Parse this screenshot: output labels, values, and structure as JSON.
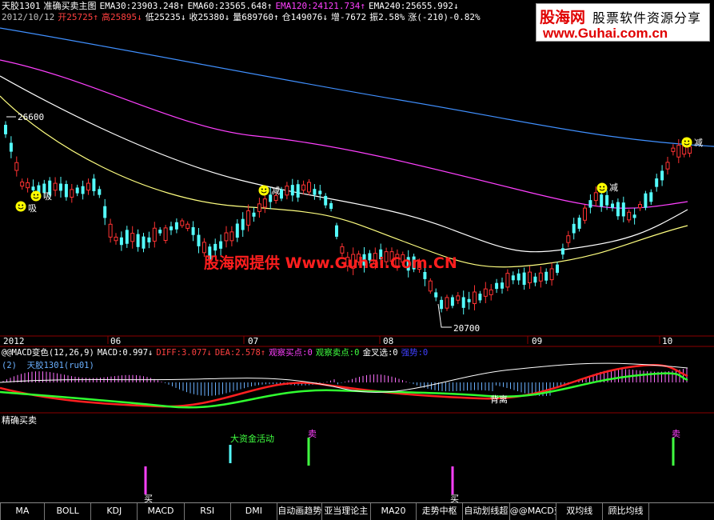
{
  "header": {
    "line1": [
      {
        "text": "天胶1301",
        "color": "#ffffff"
      },
      {
        "text": "准确买卖主图",
        "color": "#ffffff"
      },
      {
        "text": "EMA30:23903.248↑",
        "color": "#ffffff"
      },
      {
        "text": "EMA60:23565.648↑",
        "color": "#ffffff"
      },
      {
        "text": "EMA120:24121.734↑",
        "color": "#ff40ff"
      },
      {
        "text": "EMA240:25655.992↓",
        "color": "#ffffff"
      }
    ],
    "line2": [
      {
        "text": "2012/10/12",
        "color": "#c0c0c0"
      },
      {
        "text": "开25725↑",
        "color": "#ff4040"
      },
      {
        "text": "高25895↓",
        "color": "#ff4040"
      },
      {
        "text": "低25235↓",
        "color": "#ffffff"
      },
      {
        "text": "收25380↓",
        "color": "#ffffff"
      },
      {
        "text": "量689760↑",
        "color": "#ffffff"
      },
      {
        "text": "仓149076↓",
        "color": "#ffffff"
      },
      {
        "text": "增-7672",
        "color": "#ffffff"
      },
      {
        "text": "振2.58%",
        "color": "#ffffff"
      },
      {
        "text": "涨(-210)-0.82%",
        "color": "#ffffff"
      }
    ]
  },
  "logo": {
    "name": "股海网",
    "slogan": "股票软件资源分享",
    "url": "www.Guhai.com.cn"
  },
  "watermark": "股海网提供 Www.Guhai.Com.CN",
  "price_chart": {
    "high_label": "26600",
    "low_label": "20700",
    "signals": [
      {
        "label": "吸"
      },
      {
        "label": "吸"
      },
      {
        "label": "减"
      },
      {
        "label": "减"
      },
      {
        "label": "减"
      }
    ],
    "time_axis": [
      "2012",
      "06",
      "07",
      "08",
      "09",
      "10"
    ],
    "colors": {
      "up": "#ff3232",
      "down": "#54fcfc",
      "ema30": "#ffff80",
      "ema60": "#ffffff",
      "ema120": "#ff40ff",
      "ema240": "#4090ff"
    }
  },
  "macd_panel": {
    "header": [
      {
        "text": "@@MACD变色(12,26,9)",
        "color": "#ffffff"
      },
      {
        "text": "MACD:0.997↓",
        "color": "#ffffff"
      },
      {
        "text": "DIFF:3.077↓",
        "color": "#ff4040"
      },
      {
        "text": "DEA:2.578↑",
        "color": "#ff4040"
      },
      {
        "text": "观察买点:0",
        "color": "#ff40ff"
      },
      {
        "text": "观察卖点:0",
        "color": "#40ff40"
      },
      {
        "text": "金叉选:0",
        "color": "#ffffff"
      },
      {
        "text": "强势:0",
        "color": "#4040ff"
      }
    ],
    "sub_label": "(2)  天胶1301(ru01)",
    "divergence_label": "背离"
  },
  "signal_panel": {
    "title": "精确买卖",
    "big_money": "大资金活动",
    "buy_label": "买",
    "sell_label": "卖"
  },
  "tabs": [
    "MA",
    "BOLL",
    "KDJ",
    "MACD",
    "RSI",
    "DMI",
    "自动画趋势",
    "亚当理论主",
    "MA20",
    "走势中枢",
    "自动划线超",
    "@@MACD变色",
    "双均线",
    "顾比均线"
  ]
}
